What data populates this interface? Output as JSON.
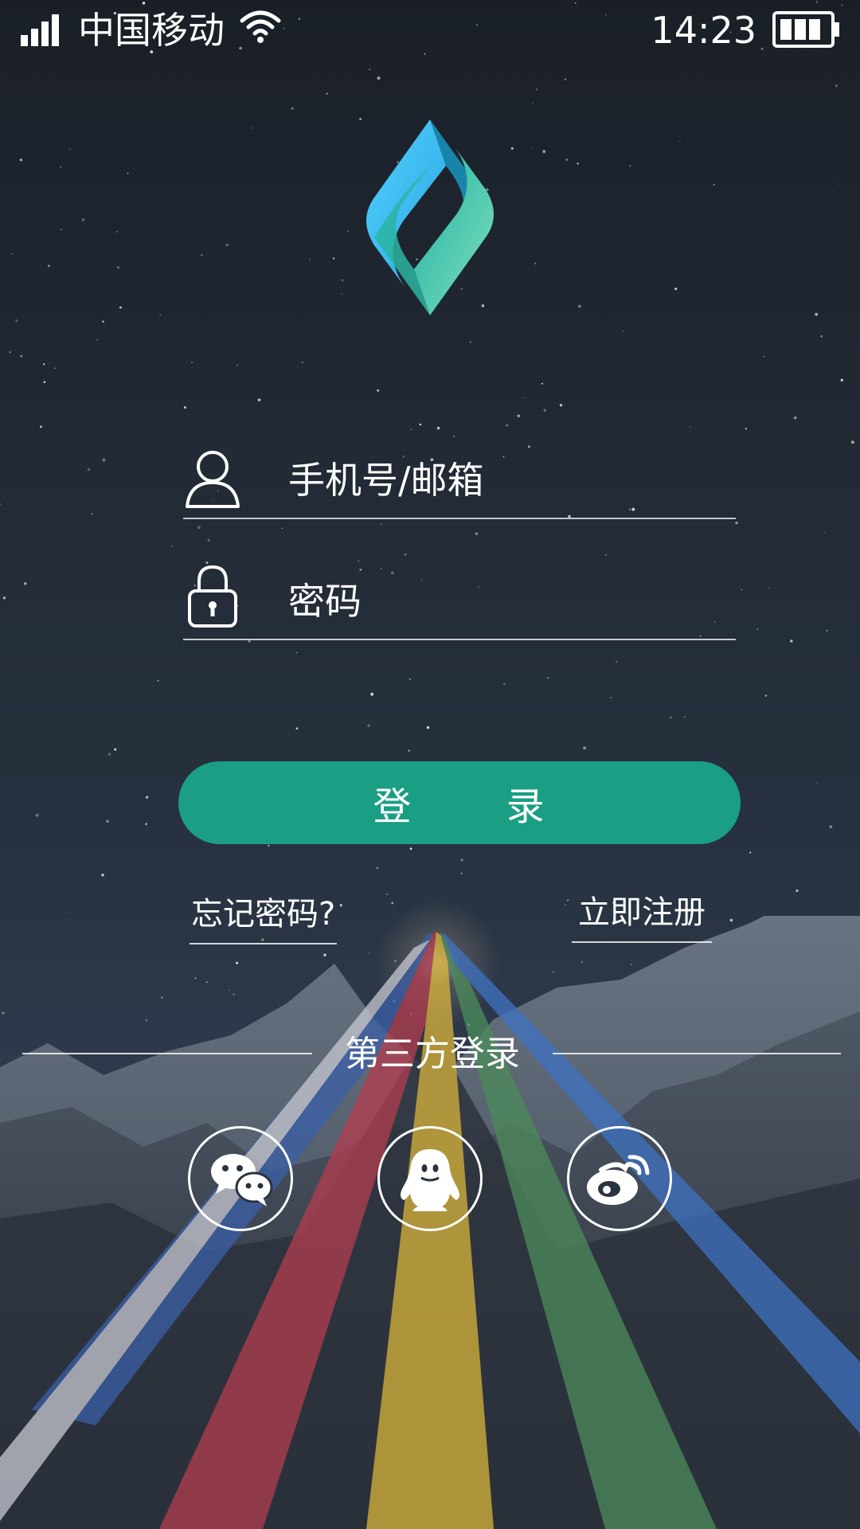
{
  "status_bar": {
    "carrier": "中国移动",
    "time": "14:23",
    "signal_icon": "signal-icon",
    "wifi_icon": "wifi-icon",
    "battery_icon": "battery-icon"
  },
  "logo": {
    "icon": "app-logo"
  },
  "form": {
    "username_placeholder": "手机号/邮箱",
    "username_value": "",
    "username_icon": "user-icon",
    "password_placeholder": "密码",
    "password_value": "",
    "password_icon": "lock-icon",
    "login_label": "登 录"
  },
  "links": {
    "forgot": "忘记密码?",
    "register": "立即注册"
  },
  "third_party": {
    "title": "第三方登录",
    "providers": [
      "wechat-icon",
      "qq-icon",
      "weibo-icon"
    ]
  },
  "colors": {
    "accent": "#1a9e84",
    "logo_blue": "#3fc3f4",
    "logo_green": "#6ed4b4"
  }
}
